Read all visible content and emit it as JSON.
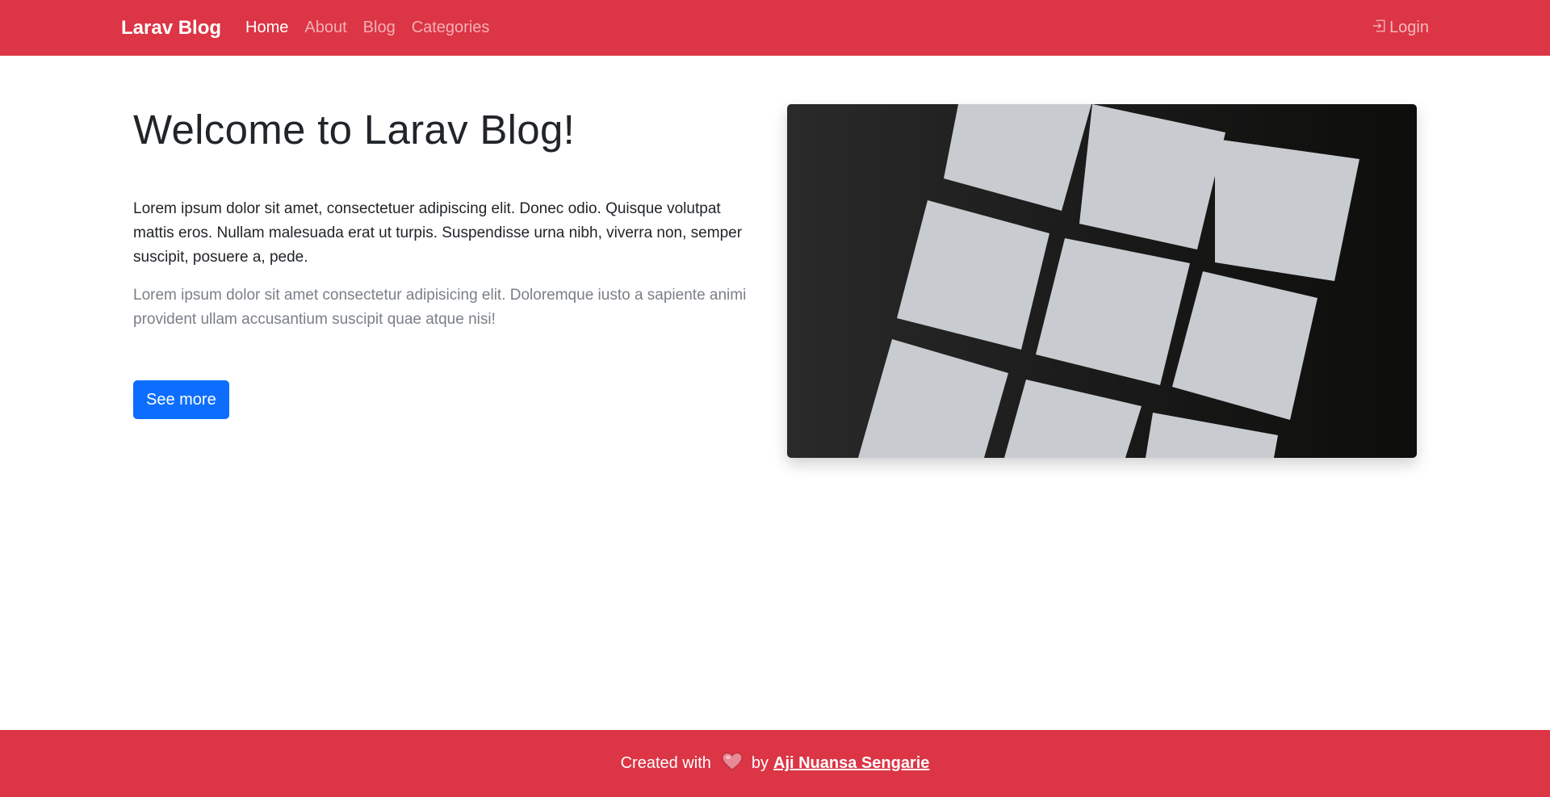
{
  "nav": {
    "brand": "Larav Blog",
    "links": [
      {
        "label": "Home",
        "active": true
      },
      {
        "label": "About",
        "active": false
      },
      {
        "label": "Blog",
        "active": false
      },
      {
        "label": "Categories",
        "active": false
      }
    ],
    "login_label": "Login",
    "login_icon": "box-arrow-in-right-icon"
  },
  "hero": {
    "title": "Welcome to Larav Blog!",
    "lead": "Lorem ipsum dolor sit amet, consectetuer adipiscing elit. Donec odio. Quisque volutpat mattis eros. Nullam malesuada erat ut turpis. Suspendisse urna nibh, viverra non, semper suscipit, posuere a, pede.",
    "muted": "Lorem ipsum dolor sit amet consectetur adipisicing elit. Doloremque iusto a sapiente animi provident ullam accusantium suscipit quae atque nisi!",
    "button_label": "See more"
  },
  "footer": {
    "prefix": "Created with",
    "heart_icon": "heart-icon",
    "by": "by",
    "author": "Aji Nuansa Sengarie"
  },
  "colors": {
    "brand_red": "#dc3545",
    "primary_blue": "#0d6efd",
    "muted_text": "#7a8087"
  }
}
